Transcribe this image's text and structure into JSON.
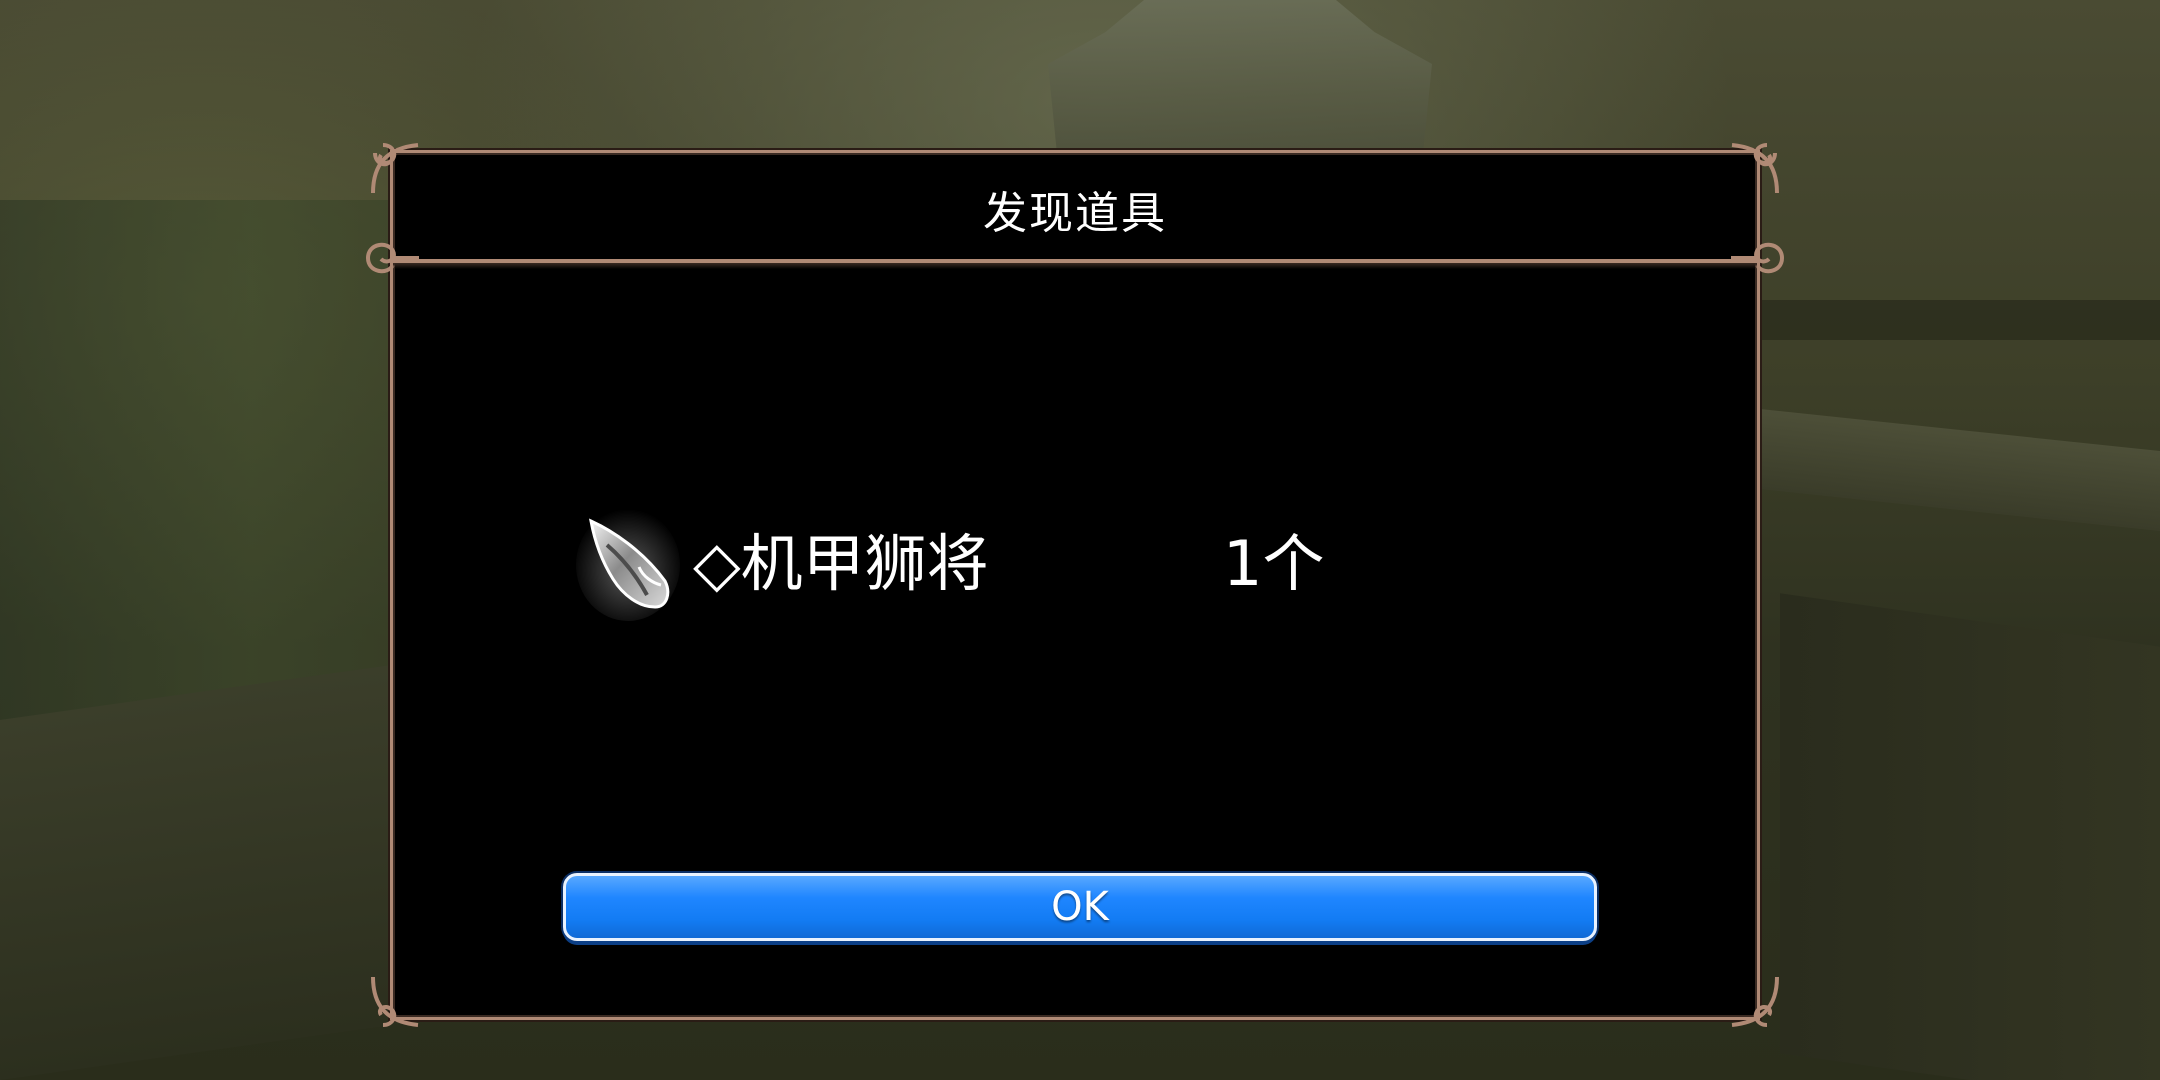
{
  "dialog": {
    "title": "发现道具",
    "item": {
      "icon": "crystal-shard-icon",
      "name": "◇机甲狮将",
      "count": "1个"
    },
    "ok_label": "OK"
  },
  "colors": {
    "frame": "#b08a75",
    "panel": "#000000",
    "button": "#1f86ff",
    "text": "#ffffff"
  }
}
